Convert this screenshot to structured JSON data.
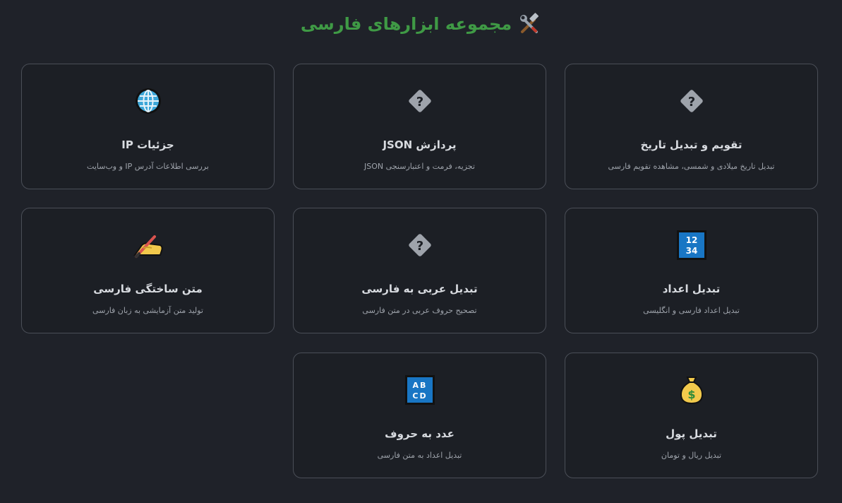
{
  "header": {
    "title": "مجموعه ابزارهای فارسی",
    "icon": "hammer-and-wrench-icon"
  },
  "colors": {
    "background": "#1f2229",
    "card_border": "#4a4e57",
    "title_green": "#3f9a45",
    "keycap_blue": "#1976c4"
  },
  "cards": [
    {
      "icon": "question-diamond-icon",
      "title": "تقویم و تبدیل تاریخ",
      "description": "تبدیل تاریخ میلادی و شمسی، مشاهده تقویم فارسی"
    },
    {
      "icon": "question-diamond-icon",
      "title": "پردازش JSON",
      "description": "تجزیه، فرمت و اعتبارسنجی JSON"
    },
    {
      "icon": "globe-icon",
      "title": "جزئیات IP",
      "description": "بررسی اطلاعات آدرس IP و وب‌سایت"
    },
    {
      "icon": "numbers-keycap-icon",
      "icon_text": [
        "12",
        "34"
      ],
      "title": "تبدیل اعداد",
      "description": "تبدیل اعداد فارسی و انگلیسی"
    },
    {
      "icon": "question-diamond-icon",
      "title": "تبدیل عربی به فارسی",
      "description": "تصحیح حروف عربی در متن فارسی"
    },
    {
      "icon": "writing-hand-icon",
      "title": "متن ساختگی فارسی",
      "description": "تولید متن آزمایشی به زبان فارسی"
    },
    {
      "icon": "money-bag-icon",
      "title": "تبدیل پول",
      "description": "تبدیل ریال و تومان"
    },
    {
      "icon": "letters-keycap-icon",
      "icon_text": [
        "AB",
        "CD"
      ],
      "title": "عدد به حروف",
      "description": "تبدیل اعداد به متن فارسی"
    }
  ]
}
